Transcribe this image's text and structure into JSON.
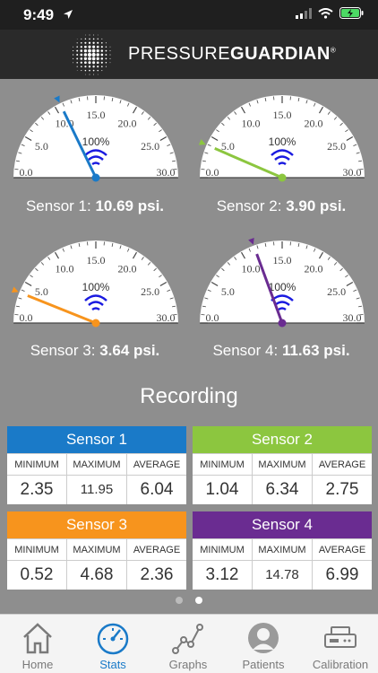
{
  "status_bar": {
    "time": "9:49"
  },
  "header": {
    "brand_light": "PRESSURE",
    "brand_bold": "GUARDIAN",
    "registered": "®"
  },
  "gauge_scale": {
    "tick_labels": [
      "0.0",
      "5.0",
      "10.0",
      "15.0",
      "20.0",
      "25.0",
      "30.0"
    ],
    "percent_label": "100%",
    "min": 0,
    "max": 30
  },
  "sensors": [
    {
      "label": "Sensor 1:",
      "value_text": "10.69 psi.",
      "value": 10.69,
      "color": "#1a7ac8"
    },
    {
      "label": "Sensor 2:",
      "value_text": "3.90 psi.",
      "value": 3.9,
      "color": "#8cc63f"
    },
    {
      "label": "Sensor 3:",
      "value_text": "3.64 psi.",
      "value": 3.64,
      "color": "#f7941d"
    },
    {
      "label": "Sensor 4:",
      "value_text": "11.63 psi.",
      "value": 11.63,
      "color": "#6a2c91"
    }
  ],
  "recording": {
    "title": "Recording",
    "col_labels": [
      "MINIMUM",
      "MAXIMUM",
      "AVERAGE"
    ],
    "cards": [
      {
        "title": "Sensor 1",
        "color": "#1a7ac8",
        "min": "2.35",
        "max": "11.95",
        "avg": "6.04"
      },
      {
        "title": "Sensor 2",
        "color": "#8cc63f",
        "min": "1.04",
        "max": "6.34",
        "avg": "2.75"
      },
      {
        "title": "Sensor 3",
        "color": "#f7941d",
        "min": "0.52",
        "max": "4.68",
        "avg": "2.36"
      },
      {
        "title": "Sensor 4",
        "color": "#6a2c91",
        "min": "3.12",
        "max": "14.78",
        "avg": "6.99"
      }
    ]
  },
  "pagination": {
    "count": 2,
    "active_index": 1
  },
  "tabs": [
    {
      "label": "Home",
      "icon": "home-icon"
    },
    {
      "label": "Stats",
      "icon": "speedometer-icon",
      "active": true
    },
    {
      "label": "Graphs",
      "icon": "graph-icon"
    },
    {
      "label": "Patients",
      "icon": "person-icon"
    },
    {
      "label": "Calibration",
      "icon": "scale-icon"
    }
  ]
}
